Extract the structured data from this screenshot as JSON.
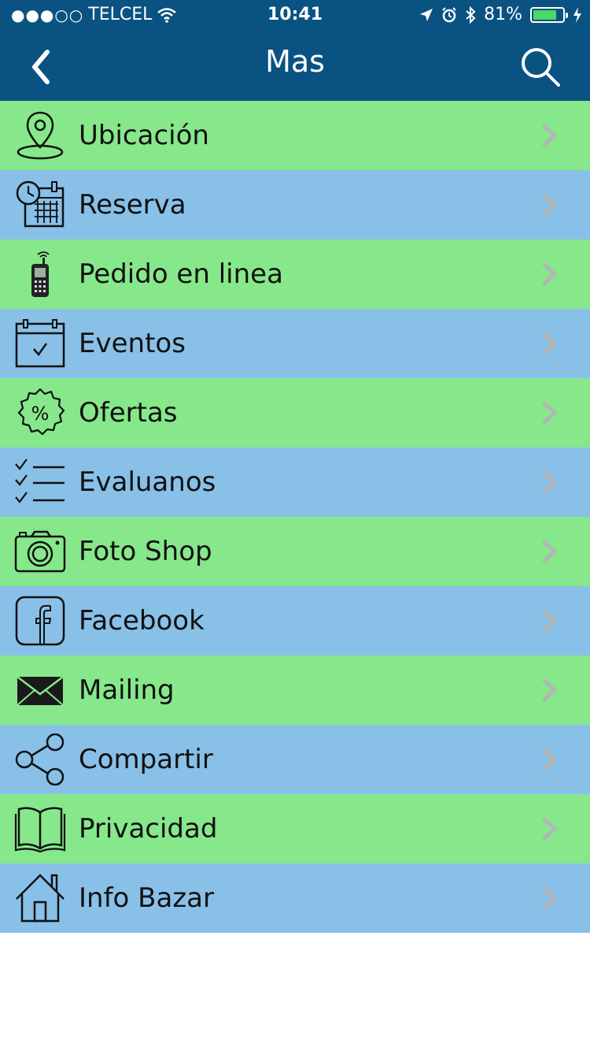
{
  "status_bar": {
    "carrier": "TELCEL",
    "signal": "●●●○○",
    "time": "10:41",
    "battery": "81%",
    "battery_level": 0.81,
    "battery_color": "#4cd964"
  },
  "nav": {
    "title": "Mas",
    "back_icon": "chevron-left-icon",
    "search_icon": "search-icon"
  },
  "colors": {
    "header": "#0a5282",
    "row_green": "#86e88a",
    "row_blue": "#88c0e8",
    "chevron": "#b5b5b5"
  },
  "menu": [
    {
      "label": "Ubicación",
      "icon": "location-pin-icon"
    },
    {
      "label": "Reserva",
      "icon": "calendar-clock-icon"
    },
    {
      "label": "Pedido en linea",
      "icon": "mobile-phone-icon"
    },
    {
      "label": "Eventos",
      "icon": "calendar-check-icon"
    },
    {
      "label": "Ofertas",
      "icon": "percent-badge-icon"
    },
    {
      "label": "Evaluanos",
      "icon": "checklist-icon"
    },
    {
      "label": "Foto Shop",
      "icon": "camera-icon"
    },
    {
      "label": "Facebook",
      "icon": "facebook-icon"
    },
    {
      "label": "Mailing",
      "icon": "envelope-icon"
    },
    {
      "label": "Compartir",
      "icon": "share-icon"
    },
    {
      "label": "Privacidad",
      "icon": "book-icon"
    },
    {
      "label": "Info Bazar",
      "icon": "house-icon"
    }
  ]
}
